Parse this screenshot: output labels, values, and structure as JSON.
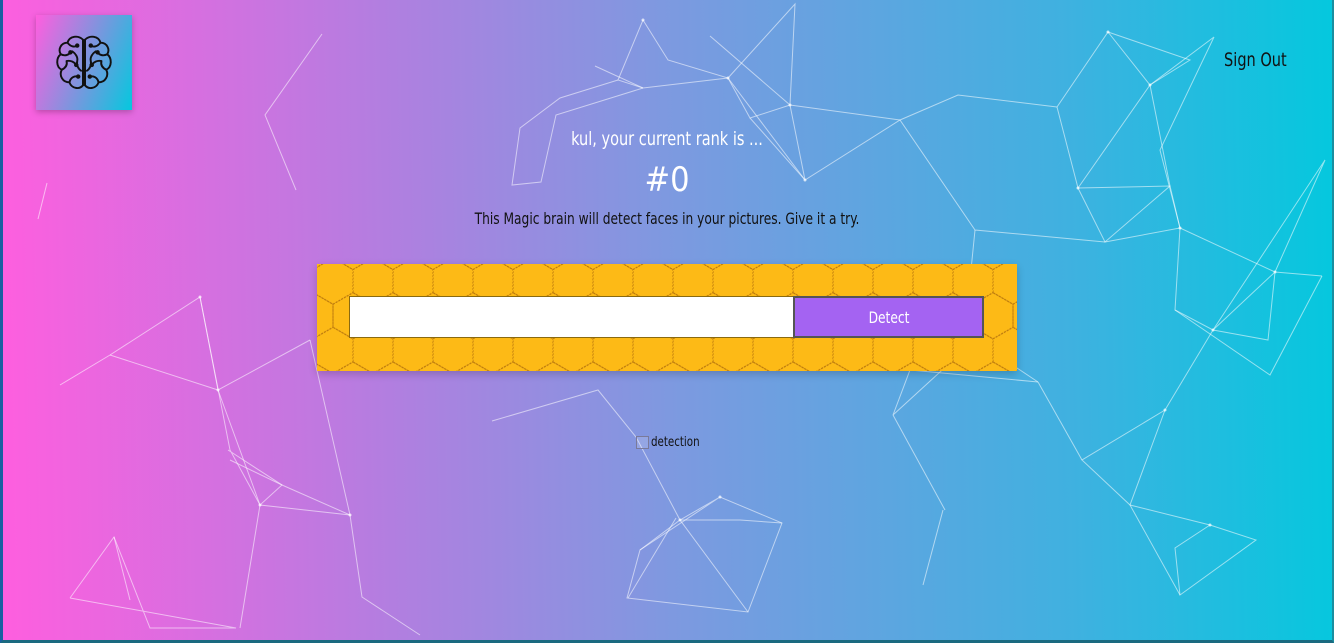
{
  "nav": {
    "signout_label": "Sign Out"
  },
  "logo": {
    "icon": "brain-icon"
  },
  "rank": {
    "greeting": "kul, your current rank is ...",
    "value": "#0"
  },
  "tagline": "This Magic brain will detect faces in your pictures. Give it a try.",
  "form": {
    "input_value": "",
    "detect_label": "Detect"
  },
  "result": {
    "image_alt": "detection"
  },
  "colors": {
    "gradient_start": "#ff5edf",
    "gradient_end": "#04c8de",
    "panel": "#fdba16",
    "button": "#a463f2"
  }
}
